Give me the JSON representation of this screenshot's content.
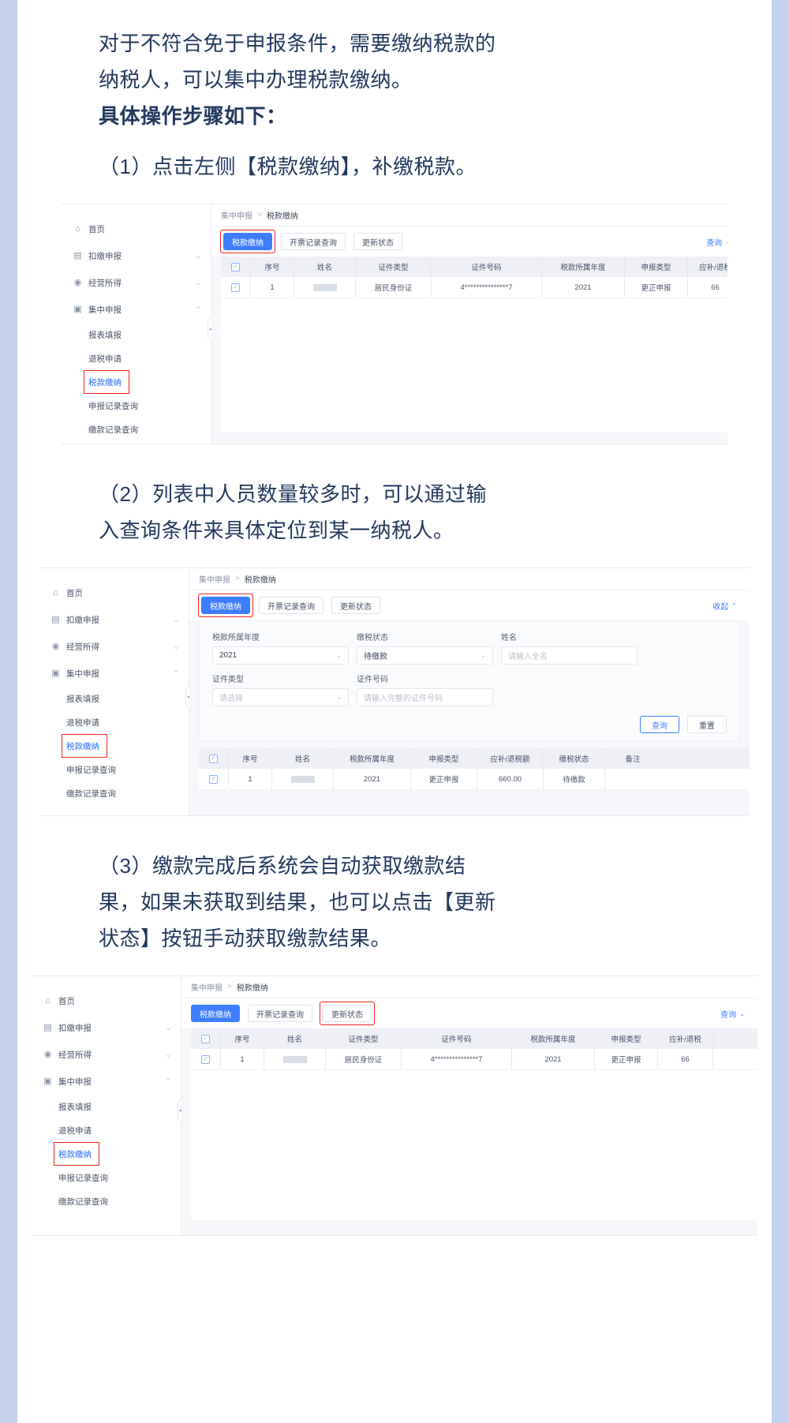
{
  "doc": {
    "intro_line1": "对于不符合免于申报条件，需要缴纳税款的",
    "intro_line2": "纳税人，可以集中办理税款缴纳。",
    "intro_bold": "具体操作步骤如下：",
    "step1": "（1）点击左侧【税款缴纳】，补缴税款。",
    "step2_line1": "（2）列表中人员数量较多时，可以通过输",
    "step2_line2": "入查询条件来具体定位到某一纳税人。",
    "step3_line1": "（3）缴款完成后系统会自动获取缴款结",
    "step3_line2": "果，如果未获取到结果，也可以点击【更新",
    "step3_line3": "状态】按钮手动获取缴款结果。"
  },
  "colors": {
    "accent": "#3d7eff",
    "highlight": "#f4241d",
    "text": "#23395d",
    "rail": "#c3d1ef"
  },
  "sidebar": {
    "items": [
      {
        "label": "首页",
        "icon": "home-icon",
        "chevron": ""
      },
      {
        "label": "扣缴申报",
        "icon": "form-icon",
        "chevron": "⌄"
      },
      {
        "label": "经营所得",
        "icon": "coin-icon",
        "chevron": "⌄"
      },
      {
        "label": "集中申报",
        "icon": "grid-icon",
        "chevron": "⌃"
      }
    ],
    "sub_items": [
      {
        "label": "报表填报",
        "active": false
      },
      {
        "label": "退税申请",
        "active": false
      },
      {
        "label": "税款缴纳",
        "active": true
      },
      {
        "label": "申报记录查询",
        "active": false
      },
      {
        "label": "缴款记录查询",
        "active": false
      }
    ],
    "collapse_icon": "◀"
  },
  "app": {
    "breadcrumb": {
      "parent": "集中申报",
      "separator": ">",
      "current": "税款缴纳"
    },
    "toolbar": {
      "pay_button": "税款缴纳",
      "invoice_button": "开票记录查询",
      "refresh_button": "更新状态",
      "query_link": "查询",
      "query_caret": "⌄",
      "collapse_link": "收起",
      "collapse_caret": "⌃"
    }
  },
  "query_form": {
    "fields": [
      {
        "label": "税款所属年度",
        "value": "2021",
        "placeholder": "",
        "type": "select"
      },
      {
        "label": "缴税状态",
        "value": "待缴款",
        "placeholder": "",
        "type": "select"
      },
      {
        "label": "姓名",
        "value": "",
        "placeholder": "请输入全名",
        "type": "input"
      },
      {
        "label": "证件类型",
        "value": "",
        "placeholder": "请选择",
        "type": "select"
      },
      {
        "label": "证件号码",
        "value": "",
        "placeholder": "请输入完整的证件号码",
        "type": "input"
      }
    ],
    "submit_button": "查询",
    "reset_button": "重置"
  },
  "table_a": {
    "headers": [
      "序号",
      "姓名",
      "证件类型",
      "证件号码",
      "税款所属年度",
      "申报类型",
      "应补/退税"
    ],
    "row": {
      "no": "1",
      "name": "",
      "id_type": "居民身份证",
      "id_no": "4***************7",
      "year": "2021",
      "decl_type": "更正申报",
      "amount": "66"
    }
  },
  "table_b": {
    "headers": [
      "序号",
      "姓名",
      "税款所属年度",
      "申报类型",
      "应补/退税额",
      "缴税状态",
      "备注"
    ],
    "row": {
      "no": "1",
      "name": "",
      "year": "2021",
      "decl_type": "更正申报",
      "amount": "660.00",
      "status": "待缴款",
      "remark": ""
    }
  }
}
